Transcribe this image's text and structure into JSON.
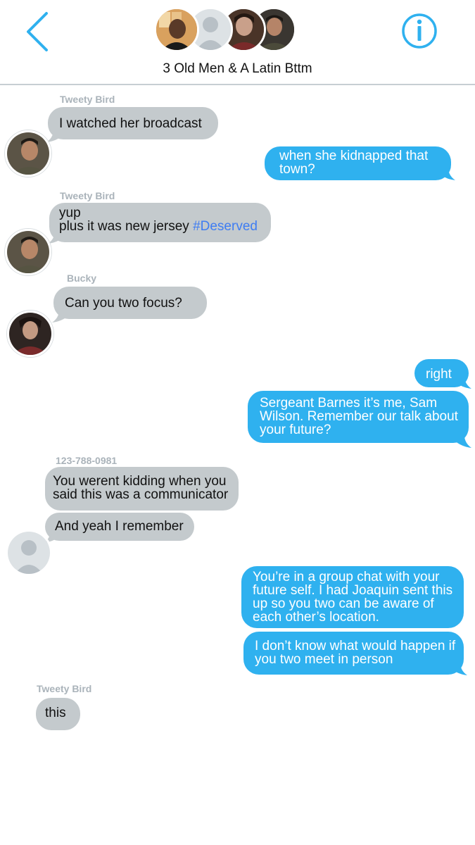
{
  "header": {
    "title": "3 Old Men & A Latin Bttm",
    "back_icon": "chevron-left-icon",
    "info_icon": "info-icon",
    "accent_color": "#2fb1ef"
  },
  "messages": [
    {
      "sender": "Tweety Bird",
      "text": "I watched her broadcast",
      "direction": "incoming"
    },
    {
      "text": "when she kidnapped that town?",
      "direction": "outgoing"
    },
    {
      "sender": "Tweety Bird",
      "line1": "yup",
      "line2": "plus it was new jersey",
      "hashtag": "#Deserved",
      "direction": "incoming"
    },
    {
      "sender": "Bucky",
      "text": "Can you two focus?",
      "direction": "incoming"
    },
    {
      "text": "right",
      "direction": "outgoing"
    },
    {
      "text": "Sergeant Barnes it’s me, Sam Wilson. Remember our talk about your future?",
      "direction": "outgoing"
    },
    {
      "sender": "123-788-0981",
      "text": "You werent kidding when you said this was a communicator",
      "direction": "incoming"
    },
    {
      "text": "And yeah I remember",
      "direction": "incoming"
    },
    {
      "text": "You’re in a group chat with your future self. I had Joaquin sent this up so you two can be aware of each other’s location.",
      "direction": "outgoing"
    },
    {
      "text": "I don’t know what would happen if you two meet in person",
      "direction": "outgoing"
    },
    {
      "sender": "Tweety Bird",
      "text": "this",
      "direction": "incoming"
    }
  ],
  "colors": {
    "incoming_bubble": "#c4cacd",
    "outgoing_bubble": "#2fb1ef",
    "hashtag": "#3f7df2",
    "sender_name": "#aab3ba"
  }
}
